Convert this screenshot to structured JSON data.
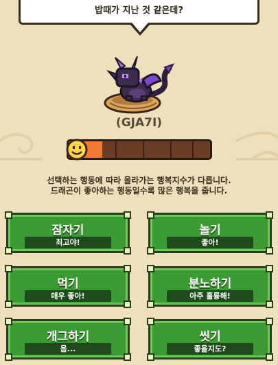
{
  "bubble": {
    "text": "밥때가 지난 것 같은데?"
  },
  "pet": {
    "name": "(GJA7I)"
  },
  "happiness": {
    "level_percent": 24,
    "colors": {
      "fill": "#f07a35",
      "empty": "#6a3e26"
    }
  },
  "description": {
    "line1": "선택하는 행동에 따라 올라가는 행복지수가 다릅니다.",
    "line2": "드래곤이 좋아하는 행동일수록 많은 행복을 줍니다."
  },
  "actions": [
    {
      "label": "잠자기",
      "reaction": "최고야!"
    },
    {
      "label": "놀기",
      "reaction": "좋아!"
    },
    {
      "label": "먹기",
      "reaction": "매우 좋아!"
    },
    {
      "label": "분노하기",
      "reaction": "아주 훌륭해!"
    },
    {
      "label": "개그하기",
      "reaction": "음..."
    },
    {
      "label": "씻기",
      "reaction": "좋을지도?"
    }
  ],
  "icons": [
    "dragon-sprite-icon",
    "smiley-face-icon"
  ]
}
